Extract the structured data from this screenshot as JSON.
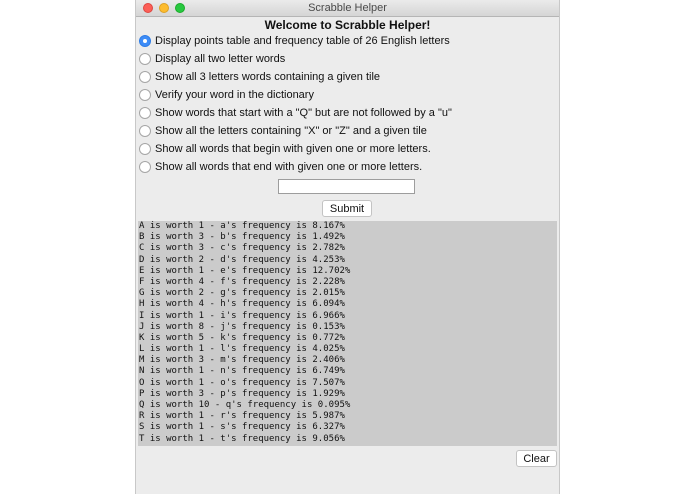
{
  "window": {
    "title": "Scrabble Helper",
    "controls": [
      "close",
      "minimize",
      "maximize"
    ]
  },
  "welcome": "Welcome to Scrabble Helper!",
  "options": [
    {
      "label": "Display points table and frequency table of 26 English letters",
      "selected": true
    },
    {
      "label": "Display all two letter words",
      "selected": false
    },
    {
      "label": "Show all 3 letters words containing a given tile",
      "selected": false
    },
    {
      "label": "Verify your word in the dictionary",
      "selected": false
    },
    {
      "label": "Show words that start with a \"Q\" but are not followed by a \"u\"",
      "selected": false
    },
    {
      "label": "Show all the letters containing \"X\" or \"Z\" and a given tile",
      "selected": false
    },
    {
      "label": "Show all words that begin with given one or more letters.",
      "selected": false
    },
    {
      "label": "Show all words that end with given one or more letters.",
      "selected": false
    }
  ],
  "input": {
    "value": "",
    "placeholder": ""
  },
  "submit_label": "Submit",
  "clear_label": "Clear",
  "output_lines": [
    "A is worth 1 - a's frequency is 8.167%",
    "B is worth 3 - b's frequency is 1.492%",
    "C is worth 3 - c's frequency is 2.782%",
    "D is worth 2 - d's frequency is 4.253%",
    "E is worth 1 - e's frequency is 12.702%",
    "F is worth 4 - f's frequency is 2.228%",
    "G is worth 2 - g's frequency is 2.015%",
    "H is worth 4 - h's frequency is 6.094%",
    "I is worth 1 - i's frequency is 6.966%",
    "J is worth 8 - j's frequency is 0.153%",
    "K is worth 5 - k's frequency is 0.772%",
    "L is worth 1 - l's frequency is 4.025%",
    "M is worth 3 - m's frequency is 2.406%",
    "N is worth 1 - n's frequency is 6.749%",
    "O is worth 1 - o's frequency is 7.507%",
    "P is worth 3 - p's frequency is 1.929%",
    "Q is worth 10 - q's frequency is 0.095%",
    "R is worth 1 - r's frequency is 5.987%",
    "S is worth 1 - s's frequency is 6.327%",
    "T is worth 1 - t's frequency is 9.056%"
  ],
  "colors": {
    "radio_selected": "#3d8cf7",
    "output_background": "#cbcbcb",
    "window_background": "#ececec"
  }
}
